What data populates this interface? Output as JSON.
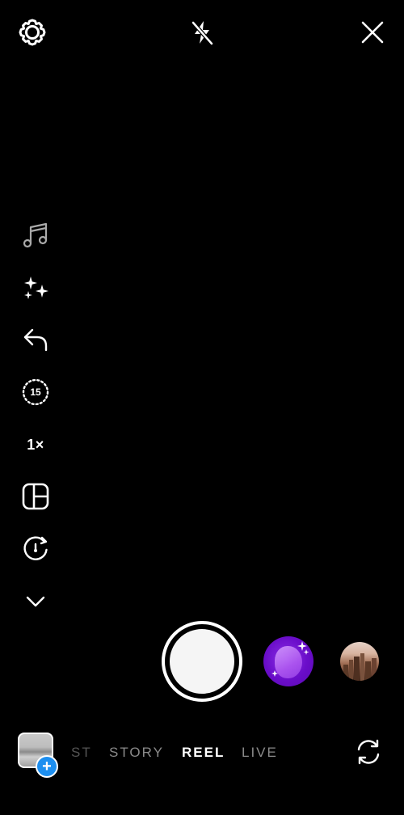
{
  "top_bar": {
    "settings_icon": "gear-icon",
    "flash_icon": "flash-off-icon",
    "close_icon": "close-icon"
  },
  "tools": {
    "music_icon": "music-note-icon",
    "effects_icon": "sparkles-icon",
    "undo_icon": "undo-arrow-icon",
    "length_value": "15",
    "speed_value": "1×",
    "layout_icon": "layout-grid-icon",
    "timer_icon": "timer-icon",
    "more_icon": "chevron-down-icon"
  },
  "capture": {
    "shutter": "shutter-button",
    "effect_thumbnail": "purple-blob-effect",
    "location_thumbnail": "city-skyline-photo"
  },
  "modes": {
    "post": "ST",
    "story": "STORY",
    "reel": "REEL",
    "live": "LIVE",
    "selected": "REEL"
  },
  "bottom_bar": {
    "gallery_badge": "+",
    "flip_icon": "flip-camera-icon"
  },
  "colors": {
    "background": "#000000",
    "active_mode": "#ffffff",
    "inactive_mode": "#8a8a8a",
    "badge_blue": "#1d8ff0",
    "effect_purple": "#6a0dc9"
  }
}
